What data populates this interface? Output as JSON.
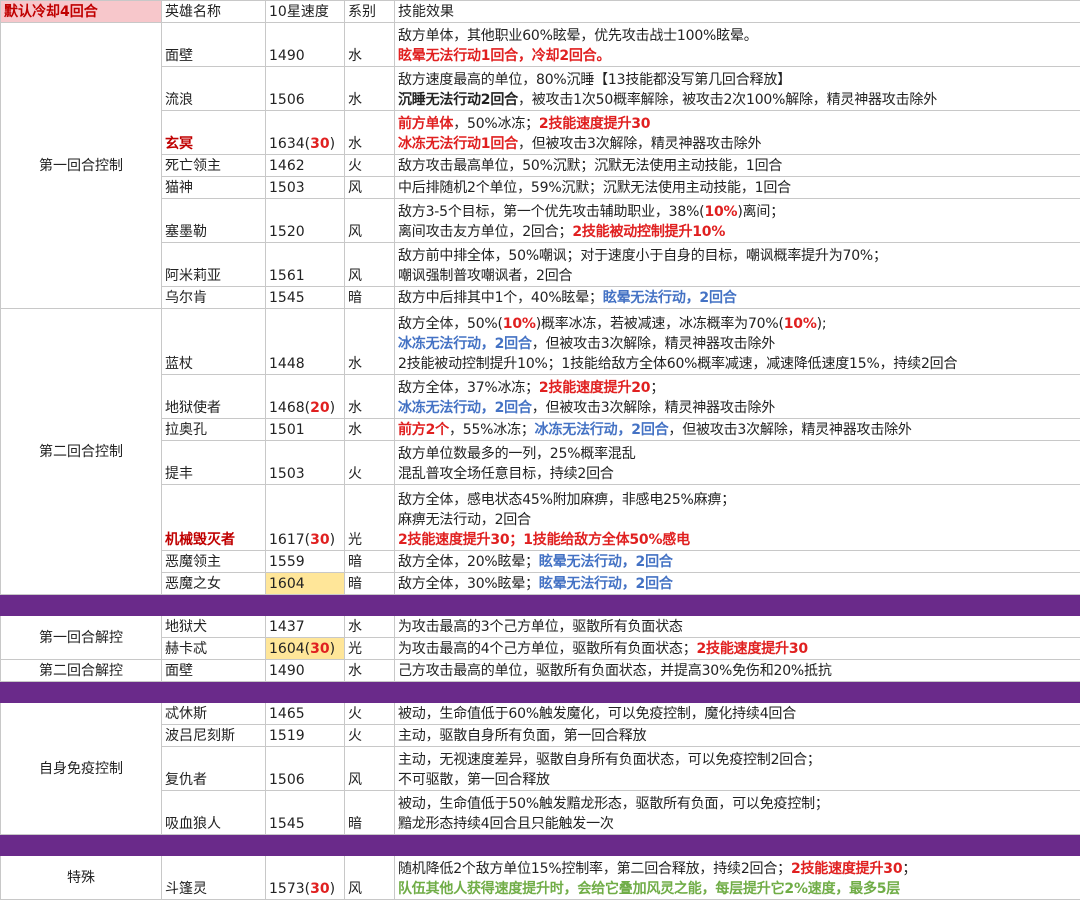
{
  "header": {
    "corner": "默认冷却4回合",
    "cols": [
      "英雄名称",
      "10星速度",
      "系别",
      "技能效果"
    ]
  },
  "colors": {
    "purple_separator": "#6a2a8a",
    "red": "#e02020",
    "blue": "#4472c4",
    "green": "#70ad47",
    "speed_highlight": "#ffe699",
    "header_pink": "#f7c7cb"
  },
  "sections": [
    {
      "category": "第一回合控制",
      "rows": [
        {
          "name": "面壁",
          "name_red": false,
          "speed": "1490",
          "speed_bonus": "",
          "speed_hl": false,
          "element": "水",
          "lines": [
            [
              [
                "n",
                "敌方单体，其他职业60%眩晕，优先攻击战士100%眩晕。"
              ]
            ],
            [
              [
                "r",
                "眩晕无法行动1回合，冷却2回合。"
              ]
            ]
          ]
        },
        {
          "name": "流浪",
          "name_red": false,
          "speed": "1506",
          "speed_bonus": "",
          "speed_hl": false,
          "element": "水",
          "lines": [
            [
              [
                "n",
                "敌方速度最高的单位，80%沉睡【13技能都没写第几回合释放】"
              ]
            ],
            [
              [
                "k",
                "沉睡无法行动2回合"
              ],
              [
                "n",
                "，被攻击1次50概率解除，被攻击2次100%解除，精灵神器攻击除外"
              ]
            ]
          ]
        },
        {
          "name": "玄冥",
          "name_red": true,
          "speed": "1634",
          "speed_bonus": "30",
          "speed_hl": false,
          "element": "水",
          "lines": [
            [
              [
                "r",
                "前方单体"
              ],
              [
                "n",
                "，50%冰冻；"
              ],
              [
                "r",
                "2技能速度提升30"
              ]
            ],
            [
              [
                "r",
                "冰冻无法行动1回合"
              ],
              [
                "n",
                "，但被攻击3次解除，精灵神器攻击除外"
              ]
            ]
          ]
        },
        {
          "name": "死亡领主",
          "name_red": false,
          "speed": "1462",
          "speed_bonus": "",
          "speed_hl": false,
          "element": "火",
          "lines": [
            [
              [
                "n",
                "敌方攻击最高单位，50%沉默；沉默无法使用主动技能，1回合"
              ]
            ]
          ]
        },
        {
          "name": "猫神",
          "name_red": false,
          "speed": "1503",
          "speed_bonus": "",
          "speed_hl": false,
          "element": "风",
          "lines": [
            [
              [
                "n",
                "中后排随机2个单位，59%沉默；沉默无法使用主动技能，1回合"
              ]
            ]
          ]
        },
        {
          "name": "塞墨勒",
          "name_red": false,
          "speed": "1520",
          "speed_bonus": "",
          "speed_hl": false,
          "element": "风",
          "lines": [
            [
              [
                "n",
                "敌方3-5个目标，第一个优先攻击辅助职业，38%("
              ],
              [
                "r",
                "10%"
              ],
              [
                "n",
                ")离间；"
              ]
            ],
            [
              [
                "n",
                "离间攻击友方单位，2回合；"
              ],
              [
                "r",
                "2技能被动控制提升10%"
              ]
            ]
          ]
        },
        {
          "name": "阿米莉亚",
          "name_red": false,
          "speed": "1561",
          "speed_bonus": "",
          "speed_hl": false,
          "element": "风",
          "lines": [
            [
              [
                "n",
                "敌方前中排全体，50%嘲讽；对于速度小于自身的目标，嘲讽概率提升为70%；"
              ]
            ],
            [
              [
                "n",
                "嘲讽强制普攻嘲讽者，2回合"
              ]
            ]
          ]
        },
        {
          "name": "乌尔肯",
          "name_red": false,
          "speed": "1545",
          "speed_bonus": "",
          "speed_hl": false,
          "element": "暗",
          "lines": [
            [
              [
                "n",
                "敌方中后排其中1个，40%眩晕；"
              ],
              [
                "b",
                "眩晕无法行动，2回合"
              ]
            ]
          ]
        }
      ]
    },
    {
      "category": "第二回合控制",
      "rows": [
        {
          "name": "蓝杖",
          "name_red": false,
          "speed": "1448",
          "speed_bonus": "",
          "speed_hl": false,
          "element": "水",
          "lines": [
            [
              [
                "n",
                "敌方全体，50%("
              ],
              [
                "r",
                "10%"
              ],
              [
                "n",
                ")概率冰冻，若被减速，冰冻概率为70%("
              ],
              [
                "r",
                "10%"
              ],
              [
                "n",
                ");"
              ]
            ],
            [
              [
                "b",
                "冰冻无法行动，2回合"
              ],
              [
                "n",
                "，但被攻击3次解除，精灵神器攻击除外"
              ]
            ],
            [
              [
                "n",
                "2技能被动控制提升10%；1技能给敌方全体60%概率减速，减速降低速度15%，持续2回合"
              ]
            ]
          ]
        },
        {
          "name": "地狱使者",
          "name_red": false,
          "speed": "1468",
          "speed_bonus": "20",
          "speed_hl": false,
          "element": "水",
          "lines": [
            [
              [
                "n",
                "敌方全体，37%冰冻；"
              ],
              [
                "r",
                "2技能速度提升20"
              ],
              [
                "n",
                "；"
              ]
            ],
            [
              [
                "b",
                "冰冻无法行动，2回合"
              ],
              [
                "n",
                "，但被攻击3次解除，精灵神器攻击除外"
              ]
            ]
          ]
        },
        {
          "name": "拉奥孔",
          "name_red": false,
          "speed": "1501",
          "speed_bonus": "",
          "speed_hl": false,
          "element": "水",
          "lines": [
            [
              [
                "r",
                "前方2个"
              ],
              [
                "n",
                "，55%冰冻；"
              ],
              [
                "b",
                "冰冻无法行动，2回合"
              ],
              [
                "n",
                "，但被攻击3次解除，精灵神器攻击除外"
              ]
            ]
          ]
        },
        {
          "name": "提丰",
          "name_red": false,
          "speed": "1503",
          "speed_bonus": "",
          "speed_hl": false,
          "element": "火",
          "lines": [
            [
              [
                "n",
                "敌方单位数最多的一列，25%概率混乱"
              ]
            ],
            [
              [
                "n",
                "混乱普攻全场任意目标，持续2回合"
              ]
            ]
          ]
        },
        {
          "name": "机械毁灭者",
          "name_red": true,
          "speed": "1617",
          "speed_bonus": "30",
          "speed_hl": false,
          "element": "光",
          "lines": [
            [
              [
                "n",
                "敌方全体，感电状态45%附加麻痹，非感电25%麻痹；"
              ]
            ],
            [
              [
                "n",
                "麻痹无法行动，2回合"
              ]
            ],
            [
              [
                "r",
                "2技能速度提升30；1技能给敌方全体50%感电"
              ]
            ]
          ]
        },
        {
          "name": "恶魔领主",
          "name_red": false,
          "speed": "1559",
          "speed_bonus": "",
          "speed_hl": false,
          "element": "暗",
          "lines": [
            [
              [
                "n",
                "敌方全体，20%眩晕；"
              ],
              [
                "b",
                "眩晕无法行动，2回合"
              ]
            ]
          ]
        },
        {
          "name": "恶魔之女",
          "name_red": false,
          "speed": "1604",
          "speed_bonus": "",
          "speed_hl": true,
          "element": "暗",
          "lines": [
            [
              [
                "n",
                "敌方全体，30%眩晕；"
              ],
              [
                "b",
                "眩晕无法行动，2回合"
              ]
            ]
          ]
        }
      ]
    },
    {
      "separator_before": true,
      "category": "第一回合解控",
      "rows": [
        {
          "name": "地狱犬",
          "name_red": false,
          "speed": "1437",
          "speed_bonus": "",
          "speed_hl": false,
          "element": "水",
          "lines": [
            [
              [
                "n",
                "为攻击最高的3个己方单位，驱散所有负面状态"
              ]
            ]
          ]
        },
        {
          "name": "赫卡忒",
          "name_red": false,
          "speed": "1604",
          "speed_bonus": "30",
          "speed_hl": true,
          "element": "光",
          "lines": [
            [
              [
                "n",
                "为攻击最高的4个己方单位，驱散所有负面状态；"
              ],
              [
                "r",
                "2技能速度提升30"
              ]
            ]
          ]
        }
      ]
    },
    {
      "category": "第二回合解控",
      "rows": [
        {
          "name": "面壁",
          "name_red": false,
          "speed": "1490",
          "speed_bonus": "",
          "speed_hl": false,
          "element": "水",
          "lines": [
            [
              [
                "n",
                "己方攻击最高的单位，驱散所有负面状态，并提高30%免伤和20%抵抗"
              ]
            ]
          ]
        }
      ]
    },
    {
      "separator_before": true,
      "category": "自身免疫控制",
      "rows": [
        {
          "name": "忒休斯",
          "name_red": false,
          "speed": "1465",
          "speed_bonus": "",
          "speed_hl": false,
          "element": "火",
          "lines": [
            [
              [
                "n",
                "被动，生命值低于60%触发魔化，可以免疫控制，魔化持续4回合"
              ]
            ]
          ]
        },
        {
          "name": "波吕尼刻斯",
          "name_red": false,
          "speed": "1519",
          "speed_bonus": "",
          "speed_hl": false,
          "element": "火",
          "lines": [
            [
              [
                "n",
                "主动，驱散自身所有负面，第一回合释放"
              ]
            ]
          ]
        },
        {
          "name": "复仇者",
          "name_red": false,
          "speed": "1506",
          "speed_bonus": "",
          "speed_hl": false,
          "element": "风",
          "lines": [
            [
              [
                "n",
                "主动，无视速度差异，驱散自身所有负面状态，可以免疫控制2回合；"
              ]
            ],
            [
              [
                "n",
                "不可驱散，第一回合释放"
              ]
            ]
          ]
        },
        {
          "name": "吸血狼人",
          "name_red": false,
          "speed": "1545",
          "speed_bonus": "",
          "speed_hl": false,
          "element": "暗",
          "lines": [
            [
              [
                "n",
                "被动，生命值低于50%触发黯龙形态，驱散所有负面，可以免疫控制；"
              ]
            ],
            [
              [
                "n",
                "黯龙形态持续4回合且只能触发一次"
              ]
            ]
          ]
        }
      ]
    },
    {
      "separator_before": true,
      "category": "特殊",
      "rows": [
        {
          "name": "斗篷灵",
          "name_red": false,
          "speed": "1573",
          "speed_bonus": "30",
          "speed_hl": false,
          "element": "风",
          "lines": [
            [
              [
                "n",
                "随机降低2个敌方单位15%控制率，第二回合释放，持续2回合；"
              ],
              [
                "r",
                "2技能速度提升30"
              ],
              [
                "n",
                "；"
              ]
            ],
            [
              [
                "g",
                "队伍其他人获得速度提升时，会给它叠加风灵之能，每层提升它2%速度，最多5层"
              ]
            ]
          ]
        }
      ]
    }
  ]
}
